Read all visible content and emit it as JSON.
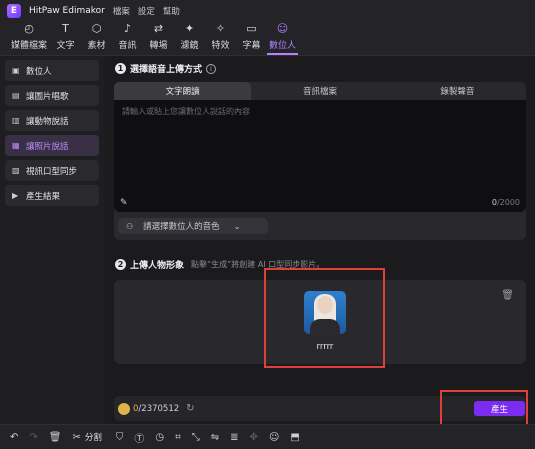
{
  "app": {
    "name": "HitPaw Edimakor",
    "menu": [
      "檔案",
      "設定",
      "幫助"
    ]
  },
  "toolbar": [
    {
      "label": "媒體檔案",
      "icon": "media-icon",
      "glyph": "◴"
    },
    {
      "label": "文字",
      "icon": "text-icon",
      "glyph": "T"
    },
    {
      "label": "素材",
      "icon": "assets-icon",
      "glyph": "⬡"
    },
    {
      "label": "音訊",
      "icon": "audio-icon",
      "glyph": "♪"
    },
    {
      "label": "轉場",
      "icon": "transition-icon",
      "glyph": "⇄"
    },
    {
      "label": "濾鏡",
      "icon": "filter-icon",
      "glyph": "✦"
    },
    {
      "label": "特效",
      "icon": "effects-icon",
      "glyph": "✧"
    },
    {
      "label": "字幕",
      "icon": "subtitle-icon",
      "glyph": "▭"
    },
    {
      "label": "數位人",
      "icon": "digital-human-icon",
      "glyph": "☺"
    }
  ],
  "sidebar": [
    {
      "label": "數位人",
      "icon": "person-icon",
      "glyph": "▣"
    },
    {
      "label": "讓圖片唱歌",
      "icon": "image-sing-icon",
      "glyph": "▤"
    },
    {
      "label": "讓動物說話",
      "icon": "animal-icon",
      "glyph": "▥"
    },
    {
      "label": "讓照片說話",
      "icon": "photo-talk-icon",
      "glyph": "▦"
    },
    {
      "label": "視訊口型同步",
      "icon": "lip-sync-icon",
      "glyph": "▧"
    },
    {
      "label": "產生結果",
      "icon": "result-icon",
      "glyph": "▶"
    }
  ],
  "step1": {
    "number": "1",
    "title": "選擇語音上傳方式",
    "tabs": [
      "文字朗讀",
      "音訊檔案",
      "錄製聲音"
    ],
    "placeholder": "請輸入或貼上您讓數位人說話的內容",
    "count": "0",
    "max": "/2000",
    "voice_label": "請選擇數位人的音色"
  },
  "step2": {
    "number": "2",
    "title": "上傳人物形象",
    "hint": "點擊“生成”將創建 AI 口型同步影片。",
    "avatar_name": "rrrrr"
  },
  "footer": {
    "credits_used": "0",
    "credits_total": "/2370512",
    "generate_label": "產生"
  },
  "edit_bar": {
    "split_label": "分割"
  },
  "colors": {
    "accent": "#b680ff",
    "button": "#7b2cf0",
    "highlight": "#e0403a"
  }
}
